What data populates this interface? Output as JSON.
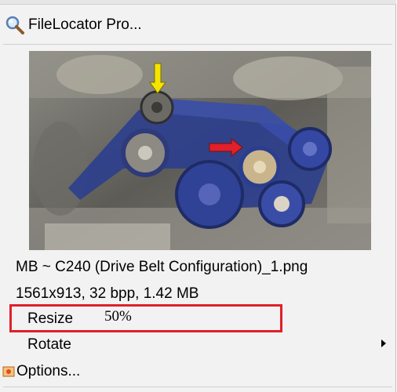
{
  "menu": {
    "filelocator": {
      "label": "FileLocator Pro...",
      "icon": "magnifier-icon"
    },
    "preview": {
      "image_name": "engine-drive-belt-photo",
      "annotations": [
        "yellow-arrow-marker",
        "red-arrow-marker"
      ]
    },
    "file_name": "MB ~ C240 (Drive Belt Configuration)_1.png",
    "file_info": "1561x913, 32 bpp, 1.42 MB",
    "resize": {
      "label": "Resize",
      "value": "50%"
    },
    "rotate": {
      "label": "Rotate",
      "icon": "submenu-arrow-icon"
    },
    "options": {
      "label": "Options...",
      "icon": "options-icon"
    }
  },
  "colors": {
    "menu_bg": "#f2f2f2",
    "highlight_border": "#e0202a",
    "belt_blue": "#2a3d8f",
    "arrow_yellow": "#f5e400",
    "arrow_red": "#e0202a"
  }
}
